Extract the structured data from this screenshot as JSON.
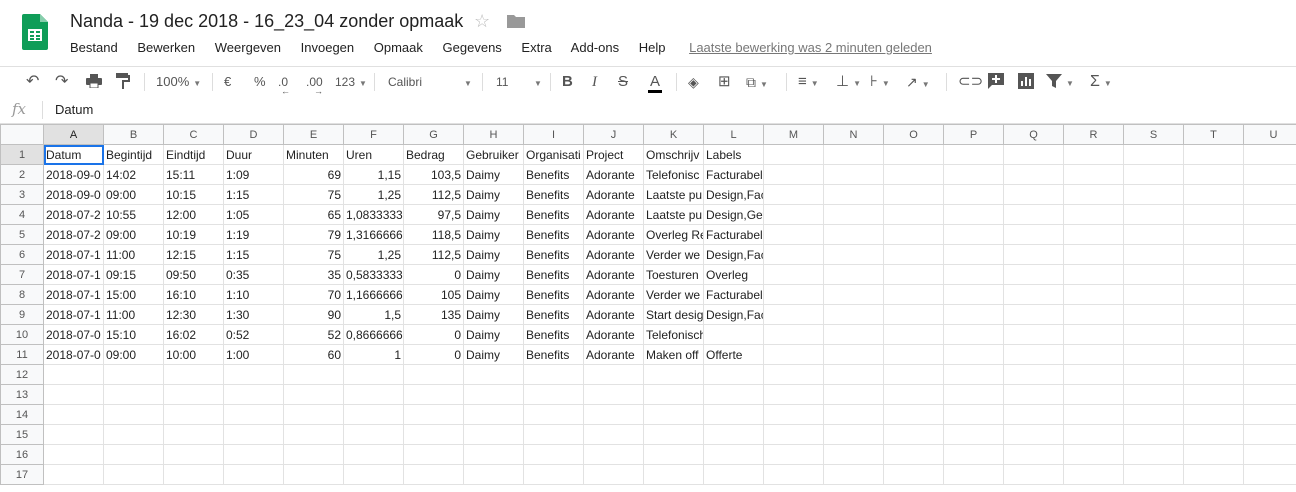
{
  "title": "Nanda - 19 dec 2018 - 16_23_04 zonder opmaak",
  "menu": [
    "Bestand",
    "Bewerken",
    "Weergeven",
    "Invoegen",
    "Opmaak",
    "Gegevens",
    "Extra",
    "Add-ons",
    "Help"
  ],
  "last_edit": "Laatste bewerking was 2 minuten geleden",
  "toolbar": {
    "zoom": "100%",
    "currency": "€",
    "percent": "%",
    "dec_less": ".0",
    "dec_more": ".00",
    "more_formats": "123",
    "font": "Calibri",
    "font_size": "11"
  },
  "formula_bar": {
    "fx": "fx",
    "content": "Datum"
  },
  "columns": [
    "A",
    "B",
    "C",
    "D",
    "E",
    "F",
    "G",
    "H",
    "I",
    "J",
    "K",
    "L",
    "M",
    "N",
    "O",
    "P",
    "Q",
    "R",
    "S",
    "T",
    "U"
  ],
  "rows": [
    [
      "Datum",
      "Begintijd",
      "Eindtijd",
      "Duur",
      "Minuten",
      "Uren",
      "Bedrag",
      "Gebruiker",
      "Organisati",
      "Project",
      "Omschrijv",
      "Labels"
    ],
    [
      "2018-09-0",
      "14:02",
      "15:11",
      "1:09",
      "69",
      "1,15",
      "103,5",
      "Daimy",
      "Benefits",
      "Adorante",
      "Telefonisc",
      "Facturabel,Gefactureerd,Begeleiding"
    ],
    [
      "2018-09-0",
      "09:00",
      "10:15",
      "1:15",
      "75",
      "1,25",
      "112,5",
      "Daimy",
      "Benefits",
      "Adorante",
      "Laatste pu",
      "Design,Facturabel,Gefactureerd"
    ],
    [
      "2018-07-2",
      "10:55",
      "12:00",
      "1:05",
      "65",
      "1,0833333",
      "97,5",
      "Daimy",
      "Benefits",
      "Adorante",
      "Laatste pu",
      "Design,Gefactureerd"
    ],
    [
      "2018-07-2",
      "09:00",
      "10:19",
      "1:19",
      "79",
      "1,3166666",
      "118,5",
      "Daimy",
      "Benefits",
      "Adorante",
      "Overleg Re",
      "Facturabel"
    ],
    [
      "2018-07-1",
      "11:00",
      "12:15",
      "1:15",
      "75",
      "1,25",
      "112,5",
      "Daimy",
      "Benefits",
      "Adorante",
      "Verder we",
      "Design,Facturabel"
    ],
    [
      "2018-07-1",
      "09:15",
      "09:50",
      "0:35",
      "35",
      "0,5833333",
      "0",
      "Daimy",
      "Benefits",
      "Adorante",
      "Toesturen",
      "Overleg"
    ],
    [
      "2018-07-1",
      "15:00",
      "16:10",
      "1:10",
      "70",
      "1,1666666",
      "105",
      "Daimy",
      "Benefits",
      "Adorante",
      "Verder we",
      "Facturabel"
    ],
    [
      "2018-07-1",
      "11:00",
      "12:30",
      "1:30",
      "90",
      "1,5",
      "135",
      "Daimy",
      "Benefits",
      "Adorante",
      "Start desig",
      "Design,Facturabel"
    ],
    [
      "2018-07-0",
      "15:10",
      "16:02",
      "0:52",
      "52",
      "0,8666666",
      "0",
      "Daimy",
      "Benefits",
      "Adorante",
      "Telefonisch contact over offerte",
      ""
    ],
    [
      "2018-07-0",
      "09:00",
      "10:00",
      "1:00",
      "60",
      "1",
      "0",
      "Daimy",
      "Benefits",
      "Adorante",
      "Maken off",
      "Offerte"
    ]
  ],
  "total_rows": 17,
  "colors": {
    "sheets_green": "#0f9d58",
    "selection_blue": "#1a73e8"
  }
}
